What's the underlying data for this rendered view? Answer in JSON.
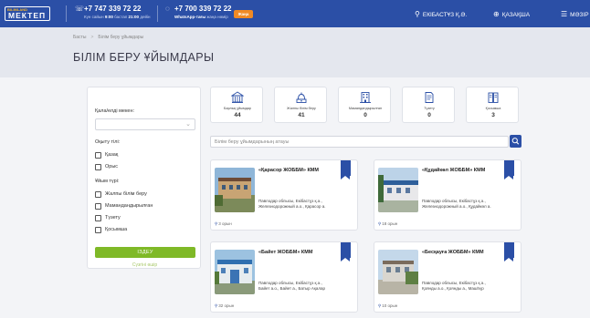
{
  "header": {
    "logo_top": "BILIMLAND",
    "logo_main": "МЕКТЕП",
    "phone1": {
      "number": "+7 747 339 72 22",
      "sub_prefix": "Күн сайын ",
      "sub_time1": "9:00",
      "sub_mid": " бастап ",
      "sub_time2": "21:00",
      "sub_suffix": " дейін"
    },
    "phone2": {
      "number": "+7 700 339 72 22",
      "sub_bold": "WhatsApp-тағы",
      "sub_rest": " жаңа нөмір"
    },
    "new_badge": "Жаңа",
    "location": "ЕКІБАСТҰЗ Қ.Ә.",
    "language": "ҚАЗАҚША",
    "menu": "МӘЗІР"
  },
  "breadcrumb": {
    "home": "Басты",
    "current": "Білім беру ұйымдары"
  },
  "page_title": "БІЛІМ БЕРУ ҰЙЫМДАРЫ",
  "filter": {
    "locality_label": "Қала/елді мекен:",
    "locality_value": "",
    "language_label": "Оқыту тілі:",
    "languages": [
      "Қазақ",
      "Орыс"
    ],
    "type_label": "Ұйым түрі:",
    "types": [
      "Жалпы білім беру",
      "Мамандандырылған",
      "Түзету",
      "Қосымша"
    ],
    "submit": "ІЗДЕУ",
    "reset": "Сүзгіні өшір"
  },
  "stats": [
    {
      "label": "Барлық ұйымдар",
      "value": "44",
      "icon": "school-building-icon"
    },
    {
      "label": "Жалпы білім беру",
      "value": "41",
      "icon": "school-bell-icon"
    },
    {
      "label": "Мамандандырылған",
      "value": "0",
      "icon": "office-building-icon"
    },
    {
      "label": "Түзету",
      "value": "0",
      "icon": "document-icon"
    },
    {
      "label": "Қосымша",
      "value": "3",
      "icon": "books-icon"
    }
  ],
  "search": {
    "placeholder": "Білім беру ұйымдарының атауы"
  },
  "cards": [
    {
      "title": "«Қарасор ЖОББМ» КММ",
      "addr1": "Павлодар облысы, Екібастұз қ.ә.,",
      "addr2": "Железнодорожный а.о., Қарасор а.",
      "seats": "3 орын"
    },
    {
      "title": "«Құдайкөл ЖОББМ» КММ",
      "addr1": "Павлодар облысы, Екібастұз қ.ә.,",
      "addr2": "Железнодорожный а.о., Құдайкөл а.",
      "seats": "18 орын"
    },
    {
      "title": "«Байет ЖОББМ» КММ",
      "addr1": "Павлодар облысы, Екібастұз қ.ә.,",
      "addr2": "Байет а.о., Байет а., Батыр Ақалар",
      "seats": "32 орын"
    },
    {
      "title": "«Бесқауға ЖОББМ» КММ",
      "addr1": "Павлодар облысы, Екібастұз қ.ә.,",
      "addr2": "Қоянды а.о., Қоянды а., Машһүр",
      "seats": "10 орын"
    }
  ],
  "colors": {
    "primary": "#2b4fa6",
    "accent": "#7fb927",
    "badge": "#f08a24"
  }
}
